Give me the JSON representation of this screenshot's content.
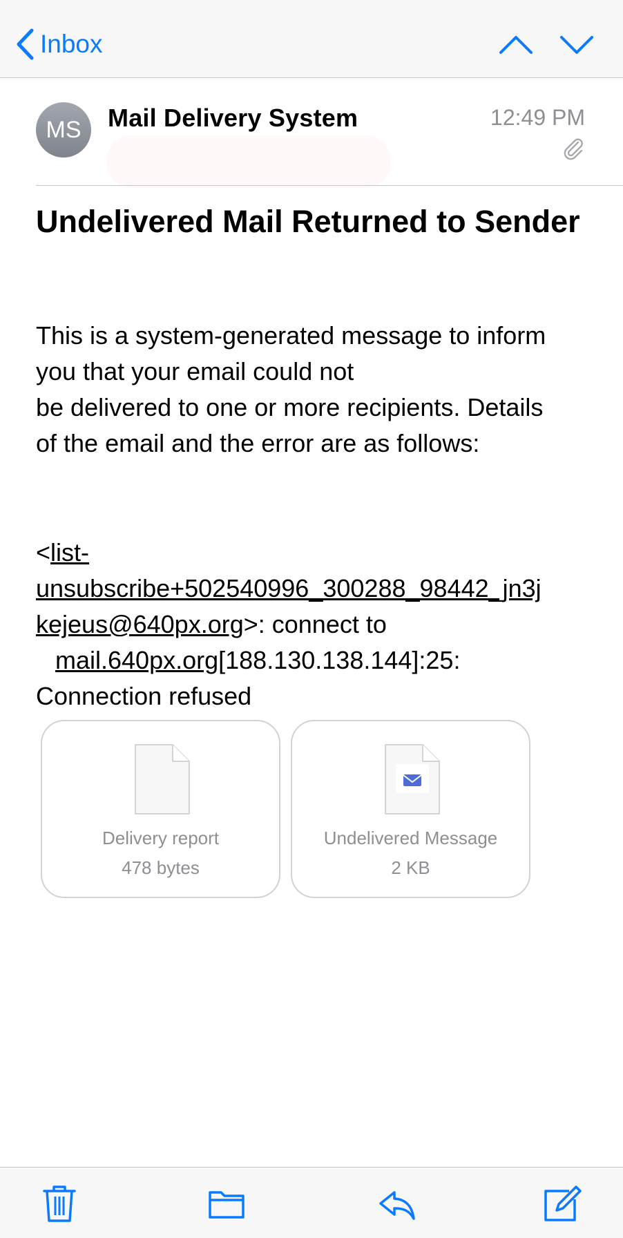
{
  "nav": {
    "back_label": "Inbox",
    "back_icon": "chevron-left-icon",
    "prev_icon": "chevron-up-icon",
    "next_icon": "chevron-down-icon",
    "accent_color": "#0a7aff"
  },
  "message": {
    "sender_initials": "MS",
    "sender_name": "Mail Delivery System",
    "time": "12:49 PM",
    "has_attachment_icon": "paperclip-icon",
    "subject": "Undelivered Mail Returned to Sender",
    "body_lines": [
      "This is a system-generated message to inform",
      "you that your email could not",
      "be delivered to one or more recipients. Details",
      "of the email and the error are as follows:"
    ],
    "error": {
      "open_bracket": "<",
      "link_line_1": "list-",
      "link_line_2": "unsubscribe+502540996_300288_98442_jn3j",
      "link_line_3": "kejeus@640px.org",
      "after_link": ">: connect to",
      "host_link": "mail.640px.org",
      "host_rest": "[188.130.138.144]:25:",
      "status": "Connection refused"
    }
  },
  "attachments": [
    {
      "name": "Delivery report",
      "size": "478 bytes",
      "icon": "document-icon"
    },
    {
      "name": "Undelivered Message",
      "size": "2 KB",
      "icon": "email-document-icon"
    }
  ],
  "toolbar": {
    "trash_icon": "trash-icon",
    "folder_icon": "folder-icon",
    "reply_icon": "reply-icon",
    "compose_icon": "compose-icon"
  }
}
